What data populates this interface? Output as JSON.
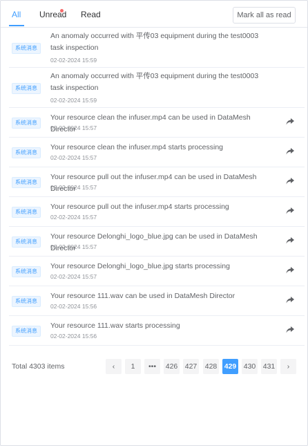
{
  "tabs": {
    "all": "All",
    "unread": "Unread",
    "read": "Read",
    "mark_all": "Mark all as read"
  },
  "colors": {
    "accent": "#409eff",
    "unread_dot": "#f56c6c"
  },
  "notifications": [
    {
      "tag": "系统消息",
      "text": "An anomaly occurred with 平传03 equipment during the test0003 task inspection",
      "time": "02-02-2024 15:59",
      "icon": null
    },
    {
      "tag": "系统消息",
      "text": "An anomaly occurred with 平传03 equipment during the test0003 task inspection",
      "time": "02-02-2024 15:59",
      "icon": null
    },
    {
      "tag": "系统消息",
      "text": "Your resource clean the infuser.mp4 can be used in DataMesh Director",
      "time": "02-02-2024 15:57",
      "icon": "share-icon"
    },
    {
      "tag": "系统消息",
      "text": "Your resource clean the infuser.mp4 starts processing",
      "time": "02-02-2024 15:57",
      "icon": "share-icon"
    },
    {
      "tag": "系统消息",
      "text": "Your resource pull out the infuser.mp4 can be used in DataMesh Director",
      "time": "02-02-2024 15:57",
      "icon": "share-icon"
    },
    {
      "tag": "系统消息",
      "text": "Your resource pull out the infuser.mp4 starts processing",
      "time": "02-02-2024 15:57",
      "icon": "share-icon"
    },
    {
      "tag": "系统消息",
      "text": "Your resource Delonghi_logo_blue.jpg can be used in DataMesh Director",
      "time": "02-02-2024 15:57",
      "icon": "share-icon"
    },
    {
      "tag": "系统消息",
      "text": "Your resource Delonghi_logo_blue.jpg starts processing",
      "time": "02-02-2024 15:57",
      "icon": "share-icon"
    },
    {
      "tag": "系统消息",
      "text": "Your resource 111.wav can be used in DataMesh Director",
      "time": "02-02-2024 15:56",
      "icon": "share-icon"
    },
    {
      "tag": "系统消息",
      "text": "Your resource 111.wav starts processing",
      "time": "02-02-2024 15:56",
      "icon": "share-icon"
    }
  ],
  "pagination": {
    "total": "Total 4303 items",
    "prev": "‹",
    "next": "›",
    "pages": [
      "1",
      "•••",
      "426",
      "427",
      "428",
      "429",
      "430",
      "431"
    ],
    "current": "429"
  }
}
